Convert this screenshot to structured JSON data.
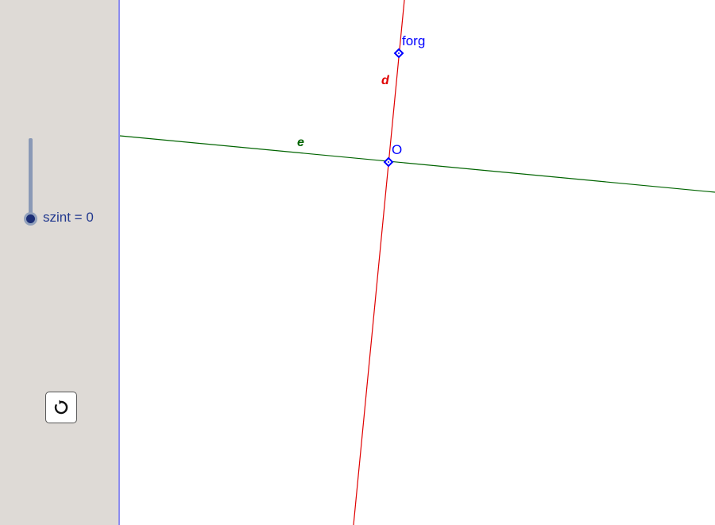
{
  "slider": {
    "name": "szint",
    "value": 0,
    "label": "szint = 0"
  },
  "reset_button": {
    "icon": "reset-icon"
  },
  "graphics": {
    "line_d": {
      "label": "d",
      "color": "#e00000"
    },
    "line_e": {
      "label": "e",
      "color": "#006400"
    },
    "point_forg": {
      "label": "forg",
      "color": "#0000ff"
    },
    "point_O": {
      "label": "O",
      "color": "#0000ff"
    }
  }
}
